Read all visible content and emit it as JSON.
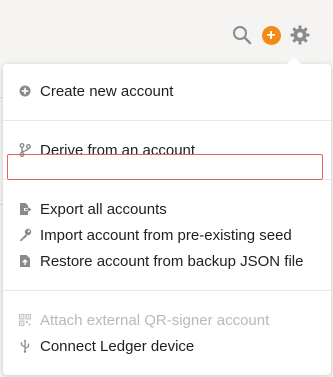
{
  "toolbar": {
    "search_icon": "search-icon",
    "add_icon": "plus-circle-icon",
    "add_label": "+",
    "settings_icon": "gear-icon",
    "accent_color": "#f28a17"
  },
  "menu": {
    "groups": [
      {
        "items": [
          {
            "label": "Create new account",
            "icon": "plus-circle-icon",
            "enabled": true
          }
        ]
      },
      {
        "items": [
          {
            "label": "Derive from an account",
            "icon": "branch-icon",
            "enabled": true
          }
        ]
      },
      {
        "items": [
          {
            "label": "Export all accounts",
            "icon": "file-export-icon",
            "enabled": true
          },
          {
            "label": "Import account from pre-existing seed",
            "icon": "key-icon",
            "enabled": true,
            "highlighted": true
          },
          {
            "label": "Restore account from backup JSON file",
            "icon": "file-upload-icon",
            "enabled": true
          }
        ]
      },
      {
        "items": [
          {
            "label": "Attach external QR-signer account",
            "icon": "qrcode-icon",
            "enabled": false
          },
          {
            "label": "Connect Ledger device",
            "icon": "usb-icon",
            "enabled": true
          }
        ]
      }
    ],
    "highlight_color": "#e06666"
  }
}
